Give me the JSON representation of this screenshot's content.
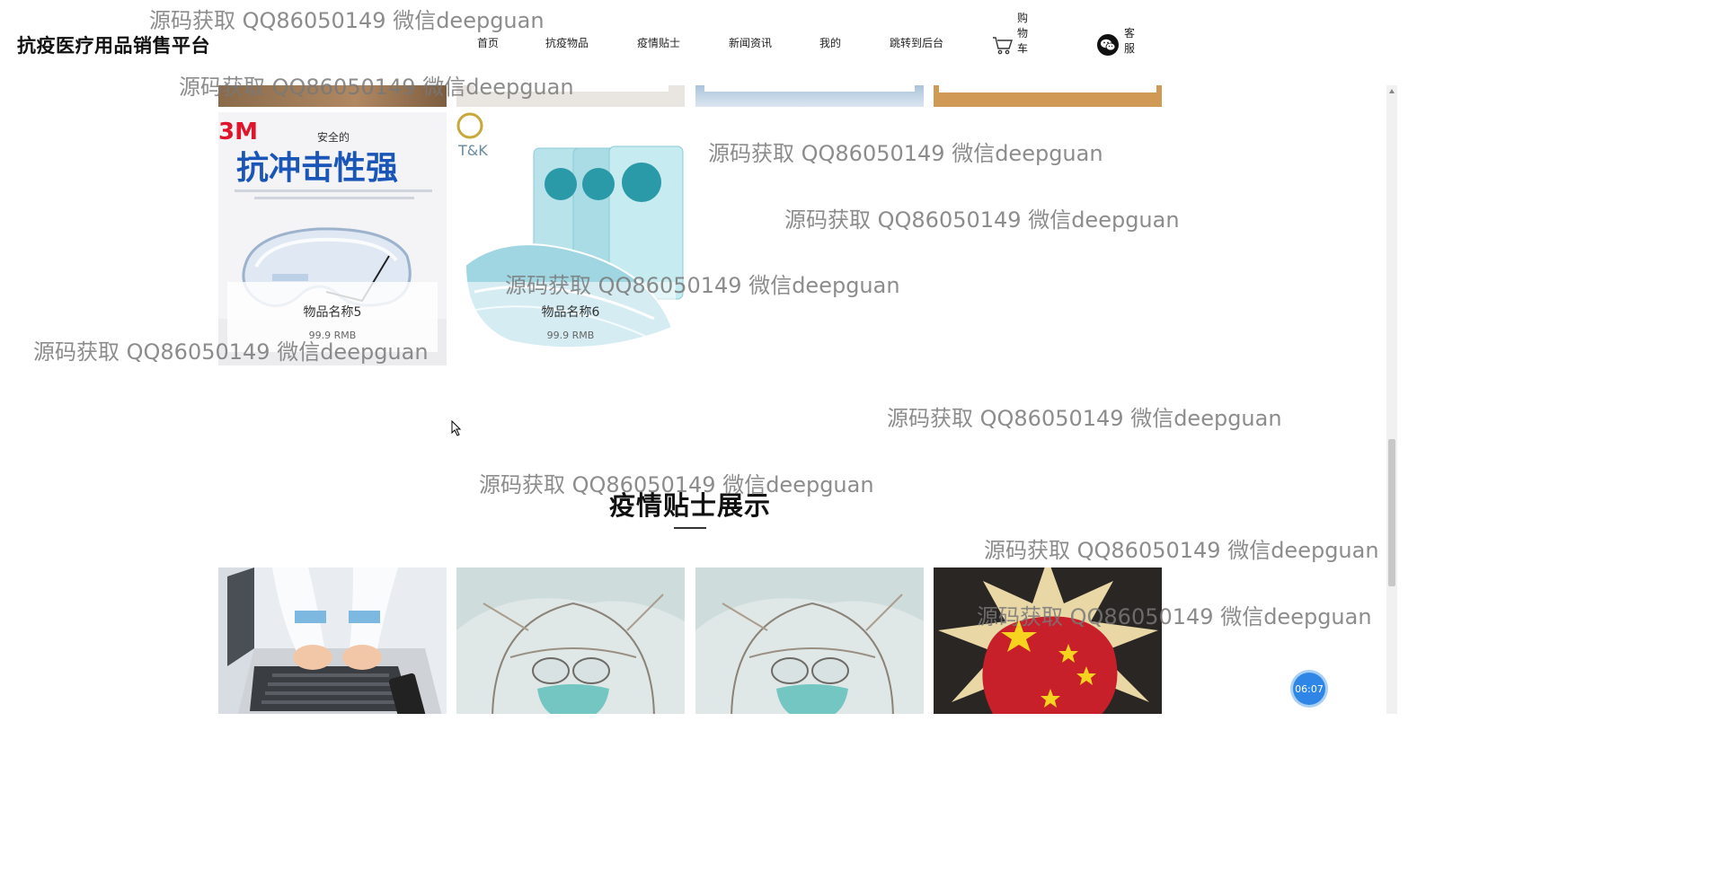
{
  "header": {
    "brand": "抗疫医疗用品销售平台",
    "nav": [
      {
        "label": "首页"
      },
      {
        "label": "抗疫物品"
      },
      {
        "label": "疫情贴士"
      },
      {
        "label": "新闻资讯"
      },
      {
        "label": "我的"
      },
      {
        "label": "跳转到后台"
      }
    ],
    "cart_label": "购物车",
    "service_label": "客服"
  },
  "products": [
    {
      "name": "物品名称5",
      "price": "99.9 RMB",
      "image": "safety-goggles-3m",
      "image_text": {
        "brand": "3M",
        "tag": "安全的",
        "headline": "抗冲击性强"
      }
    },
    {
      "name": "物品名称6",
      "price": "99.9 RMB",
      "image": "disposable-masks",
      "image_text": {
        "brand": "T&K"
      }
    }
  ],
  "tips_section": {
    "title": "疫情贴士展示",
    "images": [
      "doctor-laptop",
      "masked-health-worker",
      "masked-health-worker",
      "fist-star-poster"
    ]
  },
  "timer": "06:07",
  "watermark": "源码获取 QQ86050149 微信deepguan",
  "colors": {
    "accent": "#2f86e6",
    "text": "#222222"
  }
}
